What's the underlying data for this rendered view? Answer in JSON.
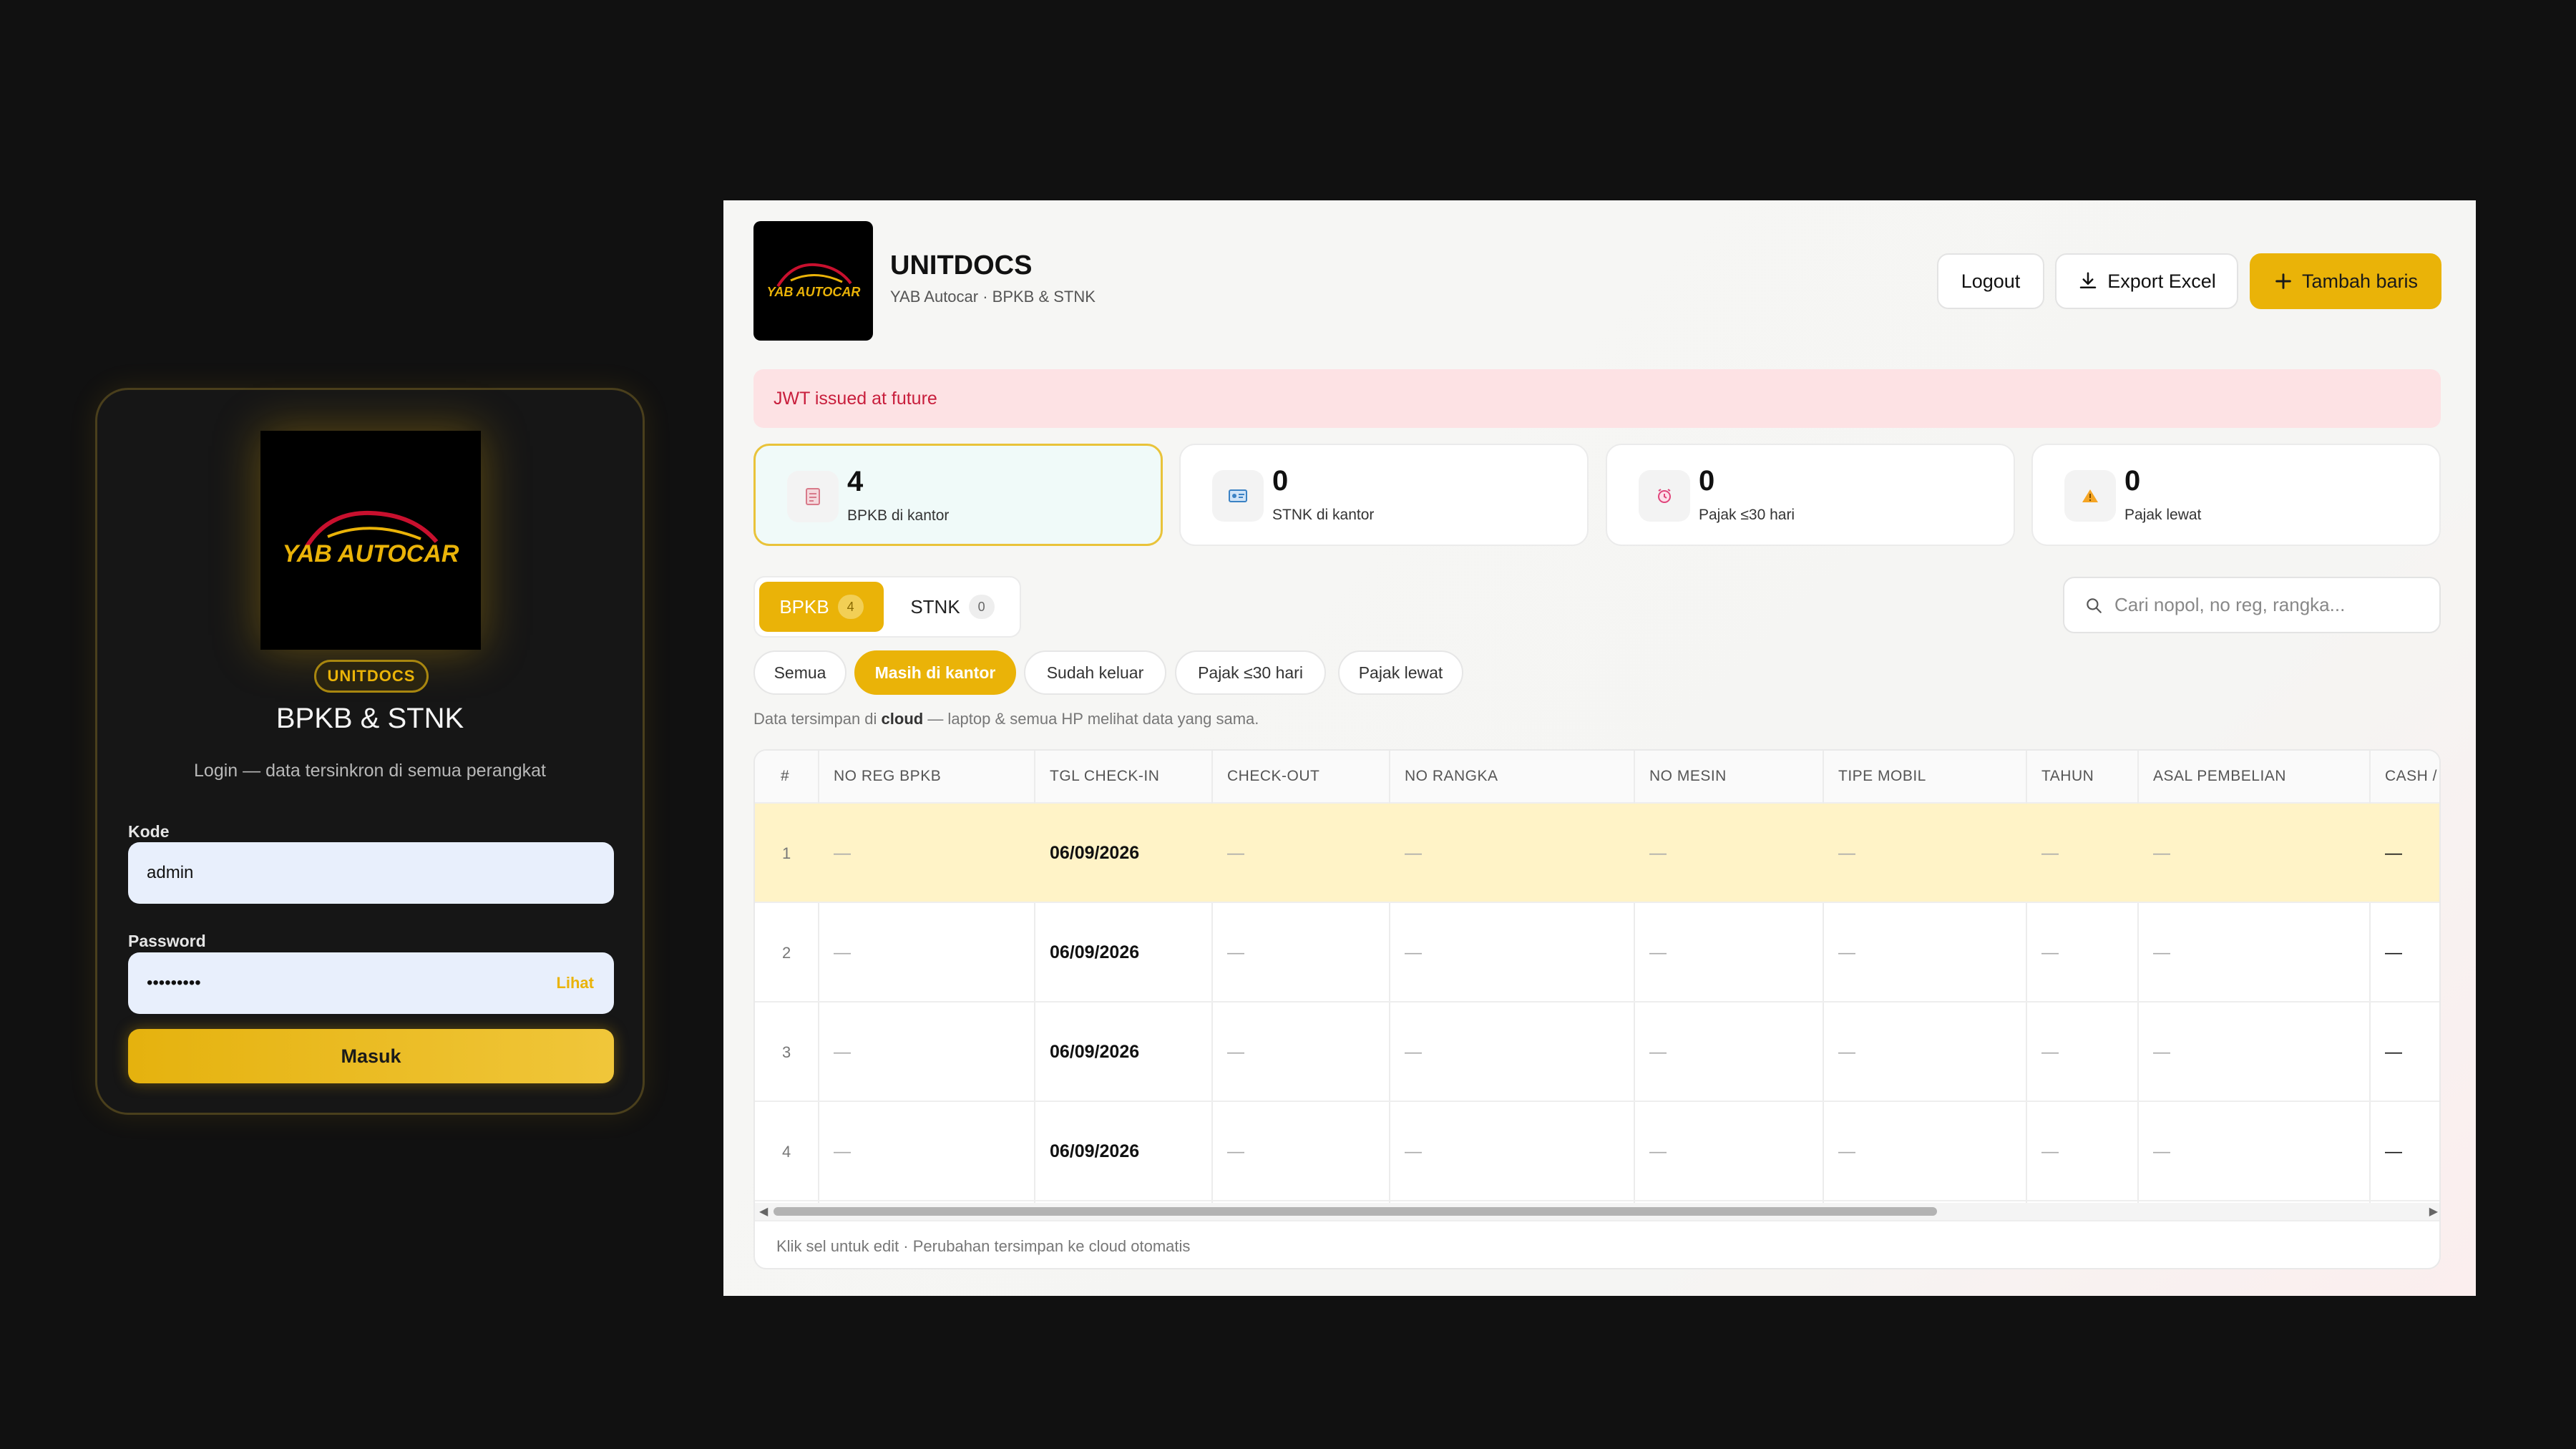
{
  "login": {
    "brand_badge": "UNITDOCS",
    "title": "BPKB & STNK",
    "subtitle": "Login — data tersinkron di semua perangkat",
    "code_label": "Kode",
    "code_value": "admin",
    "password_label": "Password",
    "password_value": "•••••••••",
    "show_password": "Lihat",
    "submit": "Masuk",
    "logo_text": "YAB AUTOCAR"
  },
  "header": {
    "title": "UNITDOCS",
    "subtitle": "YAB Autocar · BPKB & STNK",
    "logout": "Logout",
    "export": "Export Excel",
    "add_row": "Tambah baris",
    "logo_text": "YAB AUTOCAR"
  },
  "alert": "JWT issued at future",
  "stats": [
    {
      "value": "4",
      "label": "BPKB di kantor",
      "icon": "document-icon"
    },
    {
      "value": "0",
      "label": "STNK di kantor",
      "icon": "id-card-icon"
    },
    {
      "value": "0",
      "label": "Pajak ≤30 hari",
      "icon": "alarm-icon"
    },
    {
      "value": "0",
      "label": "Pajak lewat",
      "icon": "warning-icon"
    }
  ],
  "tabs": [
    {
      "label": "BPKB",
      "count": "4"
    },
    {
      "label": "STNK",
      "count": "0"
    }
  ],
  "search": {
    "placeholder": "Cari nopol, no reg, rangka..."
  },
  "filters": [
    "Semua",
    "Masih di kantor",
    "Sudah keluar",
    "Pajak ≤30 hari",
    "Pajak lewat"
  ],
  "note": {
    "before": "Data tersimpan di ",
    "bold": "cloud",
    "after": " — laptop & semua HP melihat data yang sama."
  },
  "table": {
    "columns": [
      "#",
      "NO REG BPKB",
      "TGL CHECK-IN",
      "CHECK-OUT",
      "NO RANGKA",
      "NO MESIN",
      "TIPE MOBIL",
      "TAHUN",
      "ASAL PEMBELIAN",
      "CASH /"
    ],
    "rows": [
      [
        "1",
        "—",
        "06/09/2026",
        "—",
        "—",
        "—",
        "—",
        "—",
        "—",
        "—"
      ],
      [
        "2",
        "—",
        "06/09/2026",
        "—",
        "—",
        "—",
        "—",
        "—",
        "—",
        "—"
      ],
      [
        "3",
        "—",
        "06/09/2026",
        "—",
        "—",
        "—",
        "—",
        "—",
        "—",
        "—"
      ],
      [
        "4",
        "—",
        "06/09/2026",
        "—",
        "—",
        "—",
        "—",
        "—",
        "—",
        "—"
      ]
    ],
    "footer": "Klik sel untuk edit · Perubahan tersimpan ke cloud otomatis"
  },
  "colors": {
    "accent": "#eab308",
    "alert_bg": "#fde2e4",
    "alert_text": "#c81e3c",
    "highlight_row": "#fff3c7"
  }
}
